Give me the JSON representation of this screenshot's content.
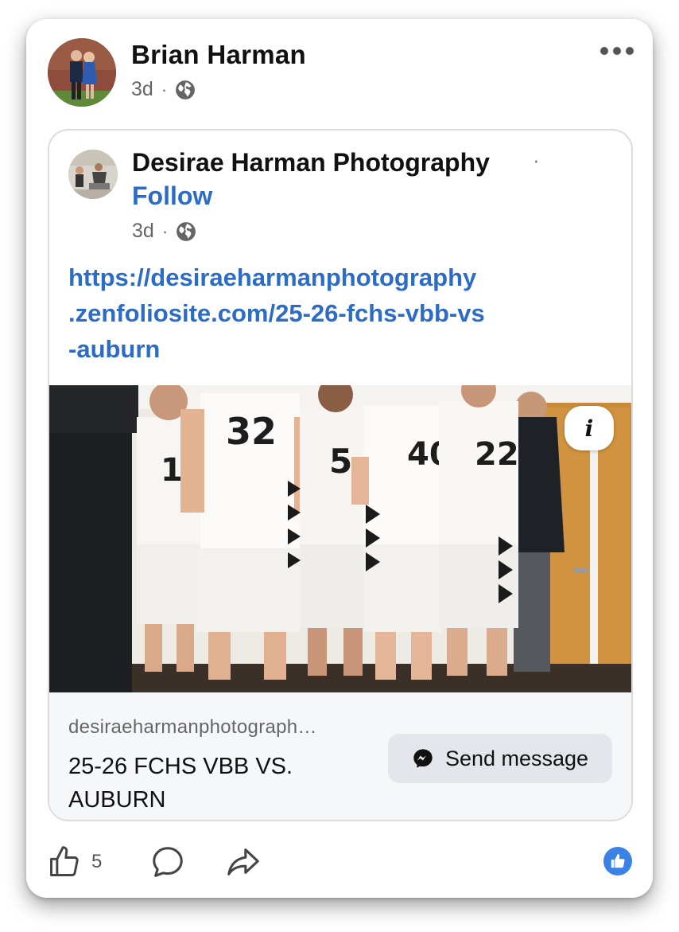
{
  "post": {
    "author": "Brian Harman",
    "time": "3d",
    "separator": "·",
    "audience_icon": "globe-icon"
  },
  "shared": {
    "page_name": "Desirae Harman Photography",
    "separator": "·",
    "follow_label": "Follow",
    "time": "3d",
    "link_lines": [
      "https://desiraeharmanphotography",
      ".zenfoliosite.com/25-26-fchs-vbb-vs",
      "-auburn"
    ],
    "photo": {
      "jersey_numbers": [
        "32",
        "12",
        "5",
        "40",
        "22"
      ],
      "info_label": "i"
    },
    "preview": {
      "domain": "desiraeharmanphotograph…",
      "title": "25-26 FCHS VBB VS. AUBURN",
      "button_label": "Send message",
      "button_icon": "messenger-icon"
    }
  },
  "actions": {
    "like_count": "5",
    "like_icon": "thumbs-up-icon",
    "comment_icon": "comment-icon",
    "share_icon": "share-icon",
    "reaction_icon": "like-reaction-icon"
  },
  "colors": {
    "link": "#2c6cc6",
    "reaction": "#3b82e6"
  }
}
